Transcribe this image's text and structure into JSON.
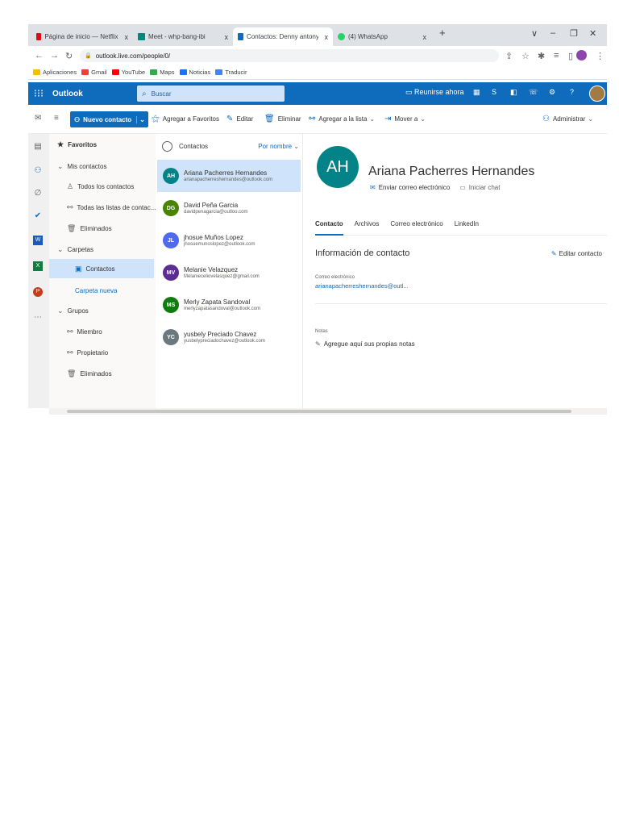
{
  "browser": {
    "tabs": [
      {
        "label": "Página de inicio — Netflix",
        "close": "x",
        "color": "#e50914"
      },
      {
        "label": "Meet - whp-bang-ibi",
        "close": "x",
        "color": "#00897b"
      },
      {
        "label": "Contactos: Denny antony vince:",
        "close": "x",
        "color": "#0f6cbd"
      },
      {
        "label": "(4) WhatsApp",
        "close": "x",
        "color": "#25d366"
      }
    ],
    "new_tab": "+",
    "window_controls": [
      "∨",
      "–",
      "❐",
      "✕"
    ],
    "url": "outlook.live.com/people/0/",
    "bookmarks": [
      {
        "label": "Aplicaciones",
        "color": "#fbbc04"
      },
      {
        "label": "Gmail",
        "color": "#ea4335"
      },
      {
        "label": "YouTube",
        "color": "#ff0000"
      },
      {
        "label": "Maps",
        "color": "#34a853"
      },
      {
        "label": "Noticias",
        "color": "#1a73e8"
      },
      {
        "label": "Traducir",
        "color": "#4285f4"
      }
    ]
  },
  "outlook": {
    "brand": "Outlook",
    "search_placeholder": "Buscar",
    "meet_now": "Reunirse ahora",
    "help": "?"
  },
  "commands": {
    "new_contact": "Nuevo contacto",
    "add_favorites": "Agregar a Favoritos",
    "edit": "Editar",
    "delete": "Eliminar",
    "add_to_list": "Agregar a la lista",
    "move_to": "Mover a",
    "manage": "Administrar"
  },
  "nav": {
    "favorites": "Favoritos",
    "my_contacts": "Mis contactos",
    "all_contacts": "Todos los contactos",
    "all_lists": "Todas las listas de contac...",
    "deleted": "Eliminados",
    "folders": "Carpetas",
    "contacts_folder": "Contactos",
    "new_folder": "Carpeta nueva",
    "groups": "Grupos",
    "member": "Miembro",
    "owner": "Propietario",
    "groups_deleted": "Eliminados"
  },
  "list": {
    "header": "Contactos",
    "sort": "Por nombre",
    "contacts": [
      {
        "initials": "AH",
        "name": "Ariana Pacherres Hernandes",
        "email": "arianapacherreshernandes@outlook.com",
        "color": "#038387"
      },
      {
        "initials": "DG",
        "name": "David Peña Garcia",
        "email": "davidpenagarcia@outloo.com",
        "color": "#498205"
      },
      {
        "initials": "JL",
        "name": "jhosue Muños Lopez",
        "email": "jhosuemunoslopez@outlook.com",
        "color": "#4f6bed"
      },
      {
        "initials": "MV",
        "name": "Melanie Velazquez",
        "email": "Melanieceliovelasquez@gmail.com",
        "color": "#5c2e91"
      },
      {
        "initials": "MS",
        "name": "Merly Zapata Sandoval",
        "email": "merlyzapatasandoval@outlook.com",
        "color": "#107c10"
      },
      {
        "initials": "YC",
        "name": "yusbely Preciado Chavez",
        "email": "yusbelypreciadochavez@outlook.com",
        "color": "#69797e"
      }
    ]
  },
  "detail": {
    "initials": "AH",
    "name": "Ariana Pacherres Hernandes",
    "send_email": "Enviar correo electrónico",
    "start_chat": "Iniciar chat",
    "tabs": [
      "Contacto",
      "Archivos",
      "Correo electrónico",
      "LinkedIn"
    ],
    "section_title": "Información de contacto",
    "edit_contact": "Editar contacto",
    "email_label": "Correo electrónico",
    "email_value": "arianapacherreshernandes@outl...",
    "notes_label": "Notas",
    "notes_placeholder": "Agregue aquí sus propias notas"
  }
}
